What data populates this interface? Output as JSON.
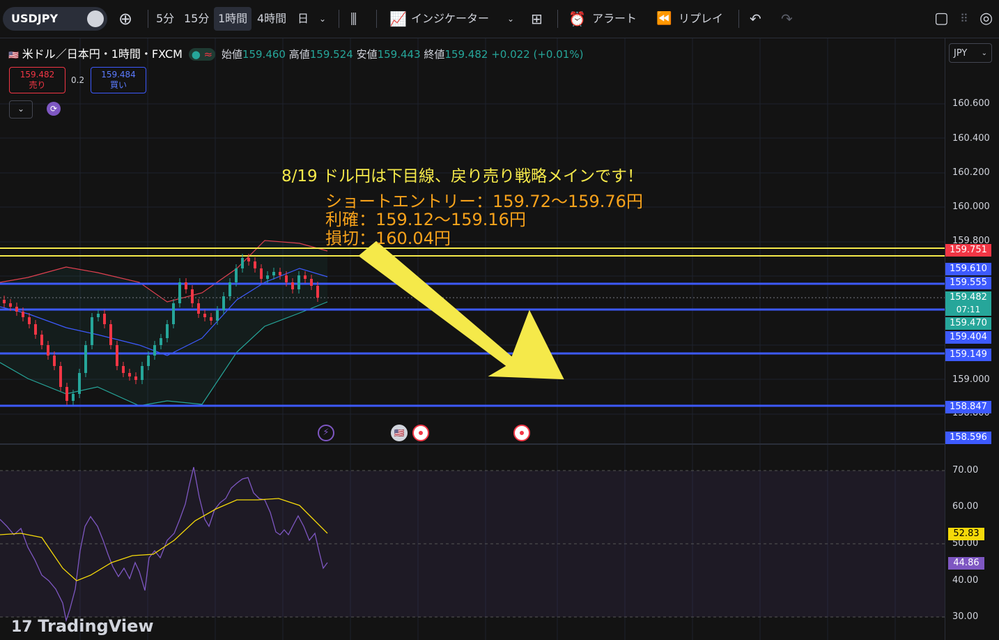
{
  "toolbar": {
    "symbol": "USDJPY",
    "timeframes": [
      "5分",
      "15分",
      "1時間",
      "4時間",
      "日"
    ],
    "active_timeframe": "1時間",
    "indicators": "インジケーター",
    "alert": "アラート",
    "replay": "リプレイ"
  },
  "legend": {
    "title": "米ドル／日本円・1時間・FXCM",
    "open_label": "始値",
    "open": "159.460",
    "high_label": "高値",
    "high": "159.524",
    "low_label": "安値",
    "low": "159.443",
    "close_label": "終値",
    "close": "159.482",
    "change": "+0.022 (+0.01%)"
  },
  "trade": {
    "sell_price": "159.482",
    "sell_label": "売り",
    "spread": "0.2",
    "buy_price": "159.484",
    "buy_label": "買い"
  },
  "currency": "JPY",
  "annotation": {
    "headline": "8/19 ドル円は下目線、戻り売り戦略メインです！",
    "line1": "ショートエントリー：159.72～159.76円",
    "line2": "利確：159.12～159.16円",
    "line3": "損切：160.04円"
  },
  "price_axis": {
    "ticks": [
      "160.600",
      "160.400",
      "160.200",
      "160.000",
      "159.800",
      "159.000",
      "158.800"
    ],
    "tags": [
      {
        "value": "159.751",
        "color": "#f23645"
      },
      {
        "value": "159.610",
        "color": "#3d5afe"
      },
      {
        "value": "159.555",
        "color": "#3d5afe"
      },
      {
        "value": "159.482",
        "color": "#26a69a"
      },
      {
        "value": "07:11",
        "color": "#26a69a"
      },
      {
        "value": "159.470",
        "color": "#26a69a"
      },
      {
        "value": "159.404",
        "color": "#3d5afe"
      },
      {
        "value": "159.149",
        "color": "#3d5afe"
      },
      {
        "value": "158.847",
        "color": "#3d5afe"
      },
      {
        "value": "158.596",
        "color": "#3d5afe"
      }
    ]
  },
  "rsi_axis": {
    "ticks": [
      "70.00",
      "60.00",
      "50.00",
      "40.00",
      "30.00"
    ],
    "tags": [
      {
        "value": "52.83",
        "color": "#f5d90a"
      },
      {
        "value": "44.86",
        "color": "#7e57c2"
      }
    ]
  },
  "watermark": "TradingView",
  "colors": {
    "yellow_line": "#f5e94a",
    "blue_line": "#3d5afe",
    "annotation_yellow": "#f5e94a",
    "annotation_orange": "#f7a21b"
  }
}
